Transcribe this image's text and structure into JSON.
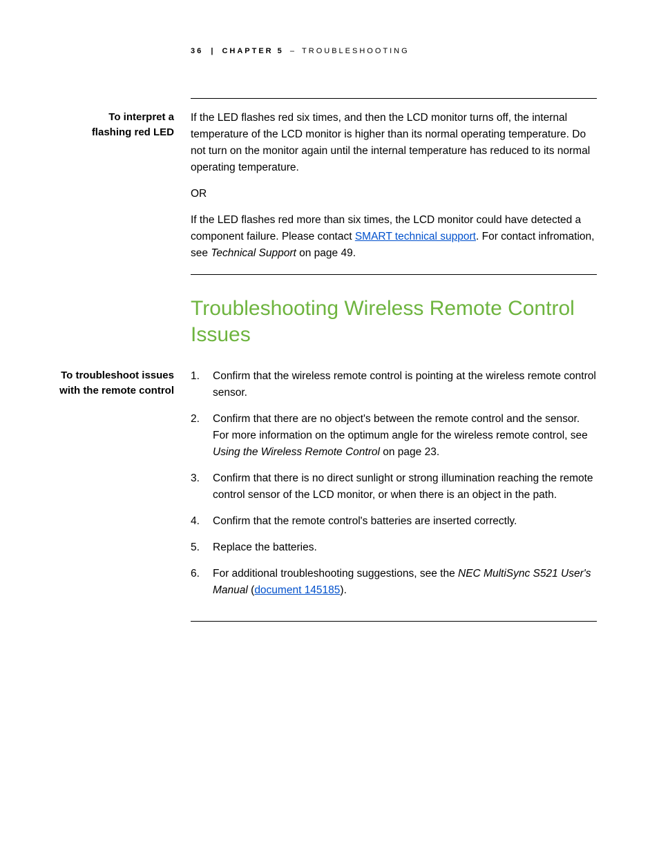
{
  "header": {
    "page_number": "36",
    "separator": "|",
    "chapter_label": "CHAPTER 5",
    "dash": "–",
    "chapter_title": "TROUBLESHOOTING"
  },
  "section1": {
    "sidehead_l1": "To interpret a",
    "sidehead_l2": "flashing red LED",
    "para1": "If the LED flashes red six times, and then the LCD monitor turns off, the internal temperature of the LCD monitor is higher than its normal operating temperature. Do not turn on the monitor again until the internal temperature has reduced to its normal operating temperature.",
    "or": "OR",
    "para2_pre": "If the LED flashes red more than six times, the LCD monitor could have detected a component failure. Please contact ",
    "para2_link": "SMART technical support",
    "para2_post1": ". For contact infromation, see ",
    "para2_ital": "Technical Support",
    "para2_post2": " on page 49."
  },
  "section2": {
    "title": "Troubleshooting Wireless Remote Control Issues",
    "sidehead_l1": "To troubleshoot issues",
    "sidehead_l2": "with the remote control",
    "steps": {
      "s1": "Confirm that the wireless remote control is pointing at the wireless remote control sensor.",
      "s2_pre": "Confirm that there are no object's between the remote control and the sensor. For more information on the optimum angle for the wireless remote control, see ",
      "s2_ital": "Using the Wireless Remote Control",
      "s2_post": " on page 23.",
      "s3": "Confirm that there is no direct sunlight or strong illumination reaching the remote control sensor of the LCD monitor, or when there is an object in the path.",
      "s4": "Confirm that the remote control's batteries are inserted correctly.",
      "s5": "Replace the batteries.",
      "s6_pre": "For additional troubleshooting suggestions, see the ",
      "s6_ital": "NEC MultiSync S521 User's Manual",
      "s6_post1": " (",
      "s6_link": "document 145185",
      "s6_post2": ")."
    }
  }
}
